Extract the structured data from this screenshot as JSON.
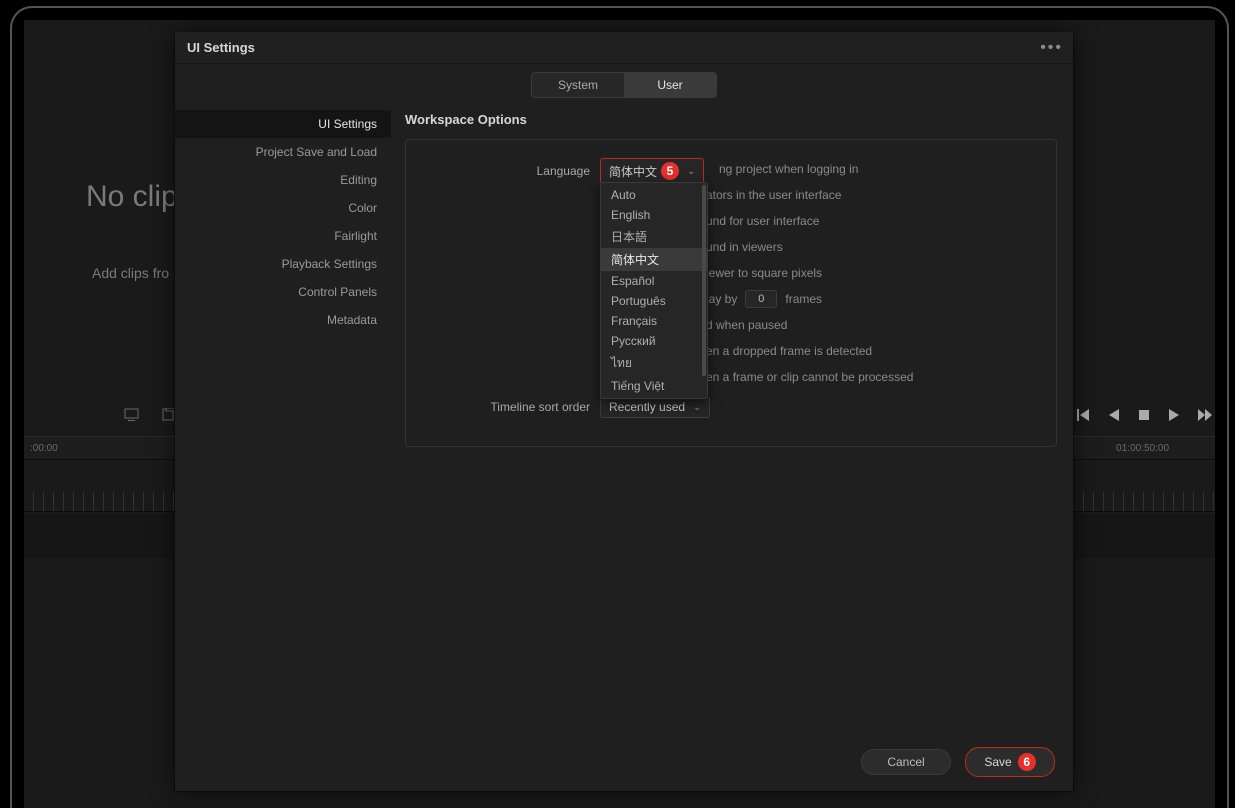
{
  "bg": {
    "no_clips": "No clip",
    "add_clips": "Add clips fro",
    "timecode_left": ":00:00",
    "timecode_right": "01:00:50:00"
  },
  "dialog": {
    "title": "UI Settings",
    "tabs": {
      "system": "System",
      "user": "User"
    },
    "sidebar": [
      "UI Settings",
      "Project Save and Load",
      "Editing",
      "Color",
      "Fairlight",
      "Playback Settings",
      "Control Panels",
      "Metadata"
    ],
    "section_title": "Workspace Options",
    "language_label": "Language",
    "language_value": "简体中文",
    "language_options": [
      "Auto",
      "English",
      "日本語",
      "简体中文",
      "Español",
      "Português",
      "Français",
      "Русский",
      "ไทย",
      "Tiếng Việt"
    ],
    "partial_lines": [
      "ng project when logging in",
      "ators in the user interface",
      "und for user interface",
      "und in viewers",
      "iewer to square pixels"
    ],
    "delay_line": {
      "prefix": "lay by",
      "value": "0",
      "unit": "frames"
    },
    "partial_lines_after": [
      "d when paused",
      "en a dropped frame is detected",
      "en a frame or clip cannot be processed"
    ],
    "sort_label": "Timeline sort order",
    "sort_value": "Recently used",
    "badges": {
      "lang": "5",
      "save": "6"
    },
    "buttons": {
      "cancel": "Cancel",
      "save": "Save"
    }
  }
}
